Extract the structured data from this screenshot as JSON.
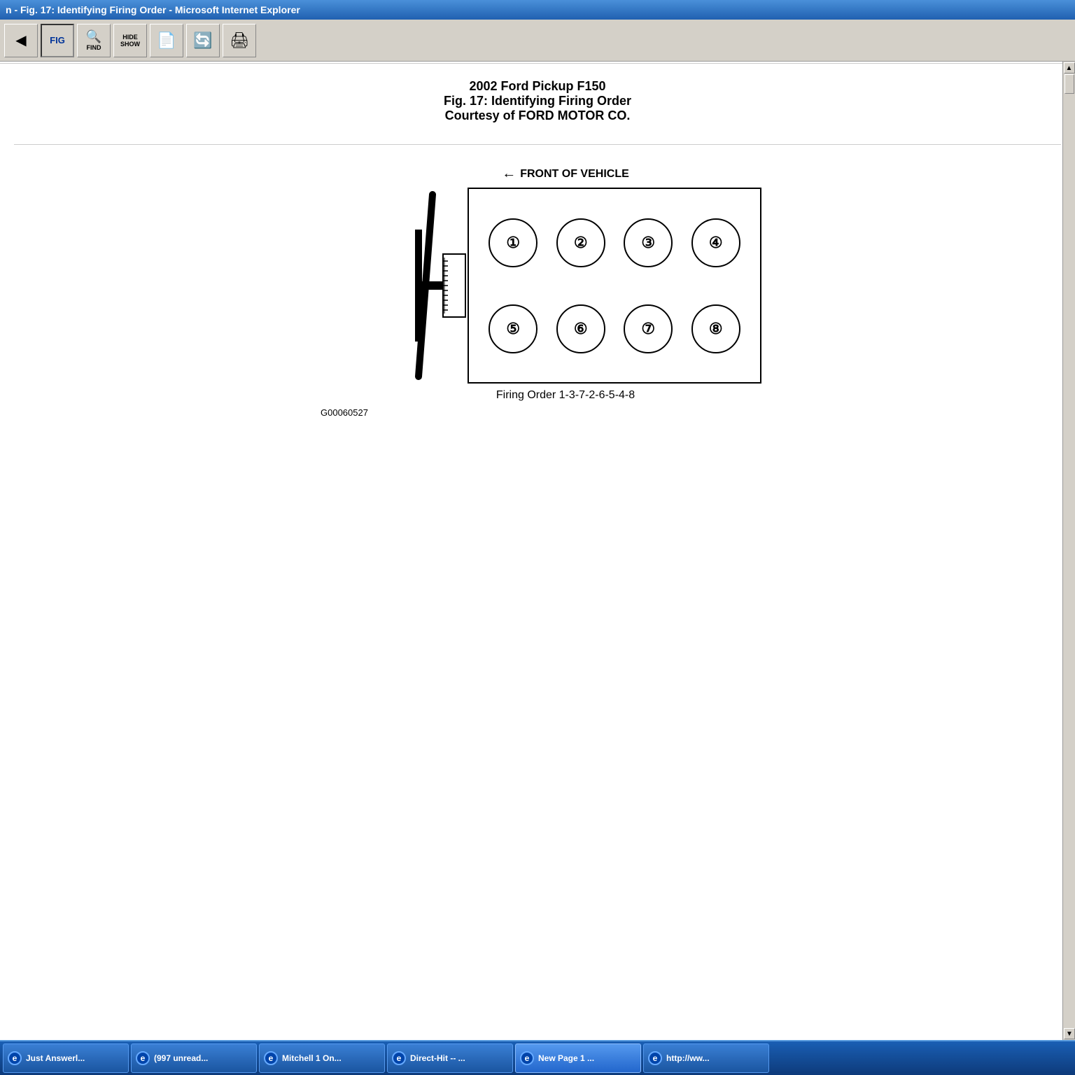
{
  "titleBar": {
    "text": "n - Fig. 17: Identifying Firing Order - Microsoft Internet Explorer"
  },
  "toolbar": {
    "buttons": [
      {
        "label": "",
        "icon": "⬅",
        "name": "back-button"
      },
      {
        "label": "FIG",
        "icon": "FIG",
        "name": "fig-button"
      },
      {
        "label": "FIND",
        "icon": "🔍",
        "name": "find-button"
      },
      {
        "label": "HIDE\nSHOW",
        "icon": "HIDE\nSHOW",
        "name": "hideshow-button"
      },
      {
        "label": "",
        "icon": "📄",
        "name": "page-button"
      },
      {
        "label": "",
        "icon": "🔄",
        "name": "refresh-button"
      },
      {
        "label": "",
        "icon": "🖨",
        "name": "print-button"
      }
    ]
  },
  "pageHeader": {
    "line1": "2002 Ford Pickup F150",
    "line2": "Fig. 17: Identifying Firing Order",
    "line3": "Courtesy of FORD MOTOR CO."
  },
  "diagram": {
    "frontLabel": "FRONT OF VEHICLE",
    "cylinders": [
      {
        "row": 1,
        "positions": [
          "①",
          "②",
          "③",
          "④"
        ]
      },
      {
        "row": 2,
        "positions": [
          "⑤",
          "⑥",
          "⑦",
          "⑧"
        ]
      }
    ],
    "firingOrder": "Firing Order 1-3-7-2-6-5-4-8",
    "partNumber": "G00060527"
  },
  "taskbar": {
    "items": [
      {
        "label": "Just Answerl...",
        "name": "taskbar-justanswer"
      },
      {
        "label": "(997 unread...",
        "name": "taskbar-email"
      },
      {
        "label": "Mitchell 1 On...",
        "name": "taskbar-mitchell"
      },
      {
        "label": "Direct-Hit -- ...",
        "name": "taskbar-directhit"
      },
      {
        "label": "New Page 1 ...",
        "name": "taskbar-newpage",
        "active": true
      },
      {
        "label": "http://ww...",
        "name": "taskbar-http"
      }
    ]
  }
}
